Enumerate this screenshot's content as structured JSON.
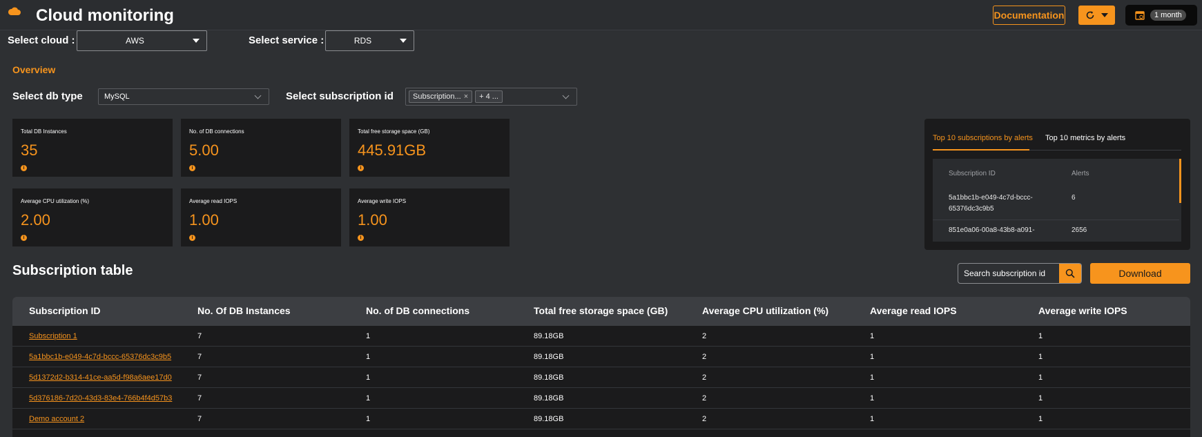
{
  "header": {
    "title": "Cloud monitoring",
    "documentation_label": "Documentation",
    "time_range": "1 month",
    "accent_color": "#f7941d",
    "icons": [
      "cloud-icon",
      "refresh-icon",
      "caret-down-icon",
      "calendar-icon"
    ]
  },
  "filters": {
    "cloud_label": "Select cloud :",
    "cloud_value": "AWS",
    "service_label": "Select service :",
    "service_value": "RDS",
    "db_type_label": "Select db type",
    "db_type_value": "MySQL",
    "subscription_label": "Select subscription id",
    "subscription_chip": "Subscription...",
    "subscription_more": "+ 4 ..."
  },
  "overview": {
    "heading": "Overview",
    "cards": [
      {
        "title": "Total DB Instances",
        "value": "35"
      },
      {
        "title": "No. of DB connections",
        "value": "5.00"
      },
      {
        "title": "Total free storage space (GB)",
        "value": "445.91GB"
      },
      {
        "title": "Average CPU utilization (%)",
        "value": "2.00"
      },
      {
        "title": "Average read IOPS",
        "value": "1.00"
      },
      {
        "title": "Average write IOPS",
        "value": "1.00"
      }
    ]
  },
  "alerts": {
    "tabs": [
      "Top 10 subscriptions by alerts",
      "Top 10 metrics by alerts"
    ],
    "active_tab": 0,
    "columns": [
      "Subscription ID",
      "Alerts"
    ],
    "rows": [
      {
        "id": "5a1bbc1b-e049-4c7d-bccc-65376dc3c9b5",
        "alerts": "6"
      },
      {
        "id": "851e0a06-00a8-43b8-a091-",
        "alerts": "2656"
      }
    ]
  },
  "subscription_table": {
    "title": "Subscription table",
    "search_placeholder": "Search subscription id",
    "download_label": "Download",
    "columns": [
      "Subscription ID",
      "No. Of DB Instances",
      "No. of DB connections",
      "Total free storage space (GB)",
      "Average CPU utilization (%)",
      "Average read IOPS",
      "Average write IOPS"
    ],
    "rows": [
      [
        "Subscription 1",
        "7",
        "1",
        "89.18GB",
        "2",
        "1",
        "1"
      ],
      [
        "5a1bbc1b-e049-4c7d-bccc-65376dc3c9b5",
        "7",
        "1",
        "89.18GB",
        "2",
        "1",
        "1"
      ],
      [
        "5d1372d2-b314-41ce-aa5d-f98a6aee17d0",
        "7",
        "1",
        "89.18GB",
        "2",
        "1",
        "1"
      ],
      [
        "5d376186-7d20-43d3-83e4-766b4f4d57b3",
        "7",
        "1",
        "89.18GB",
        "2",
        "1",
        "1"
      ],
      [
        "Demo account 2",
        "7",
        "1",
        "89.18GB",
        "2",
        "1",
        "1"
      ]
    ]
  }
}
